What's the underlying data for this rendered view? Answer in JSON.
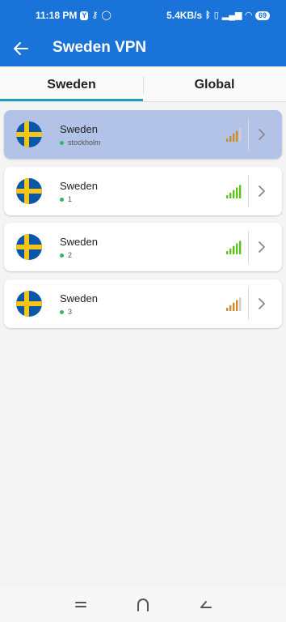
{
  "status_bar": {
    "time": "11:18 PM",
    "network_speed": "5.4KB/s",
    "battery": "69",
    "icons": [
      "y-box-icon",
      "key-icon",
      "circle-icon",
      "bluetooth-icon",
      "vibrate-icon",
      "signal-icon",
      "wifi-icon",
      "battery-icon"
    ]
  },
  "header": {
    "title": "Sweden VPN",
    "back_icon": "arrow-left-icon",
    "background_color": "#1a73d9"
  },
  "tabs": [
    {
      "label": "Sweden",
      "selected": true
    },
    {
      "label": "Global",
      "selected": false
    }
  ],
  "servers": [
    {
      "country": "Sweden",
      "city": "stockholm",
      "signal": 4,
      "signal_color": "#d08a2a",
      "selected": true
    },
    {
      "country": "Sweden",
      "city": "1",
      "signal": 5,
      "signal_color": "#5cc21e",
      "selected": false
    },
    {
      "country": "Sweden",
      "city": "2",
      "signal": 5,
      "signal_color": "#5cc21e",
      "selected": false
    },
    {
      "country": "Sweden",
      "city": "3",
      "signal": 4,
      "signal_color": "#d08a2a",
      "selected": false
    }
  ],
  "nav": {
    "icons": [
      "menu-icon",
      "home-icon",
      "back-icon"
    ]
  },
  "colors": {
    "accent": "#1a73d9",
    "tab_underline": "#1aa0b8",
    "selected_card": "#b3c3e8",
    "online_dot": "#2cb868"
  }
}
